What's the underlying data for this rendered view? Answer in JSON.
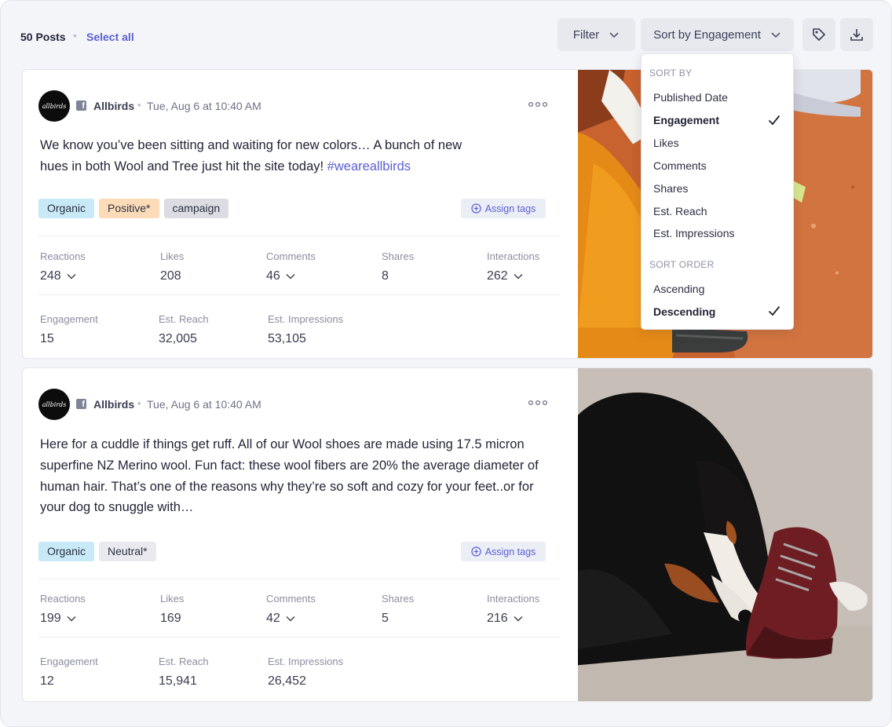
{
  "toolbar": {
    "post_count": "50 Posts",
    "separator": "•",
    "select_all": "Select all",
    "filter_label": "Filter",
    "sort_label": "Sort by Engagement"
  },
  "sort_menu": {
    "sort_by_heading": "SORT BY",
    "sort_by_options": [
      "Published Date",
      "Engagement",
      "Likes",
      "Comments",
      "Shares",
      "Est. Reach",
      "Est. Impressions"
    ],
    "selected_sort_by": "Engagement",
    "sort_order_heading": "SORT ORDER",
    "sort_order_options": [
      "Ascending",
      "Descending"
    ],
    "selected_sort_order": "Descending"
  },
  "posts": [
    {
      "avatar_text": "allbirds",
      "network_icon": "facebook-icon",
      "author": "Allbirds",
      "separator": "•",
      "timestamp": "Tue, Aug 6 at 10:40 AM",
      "text_lines": [
        "We know you’ve been sitting and waiting for new colors… A bunch of new",
        "hues in both Wool and Tree just hit the site today! "
      ],
      "hashtag": "#weareallbirds",
      "tags": [
        "Organic",
        "Positive*",
        "campaign"
      ],
      "assign_tags": "Assign tags",
      "metrics_row1": [
        {
          "label": "Reactions",
          "value": "248",
          "expandable": true
        },
        {
          "label": "Likes",
          "value": "208",
          "expandable": false
        },
        {
          "label": "Comments",
          "value": "46",
          "expandable": true
        },
        {
          "label": "Shares",
          "value": "8",
          "expandable": false
        },
        {
          "label": "Interactions",
          "value": "262",
          "expandable": true
        }
      ],
      "metrics_row2": [
        {
          "label": "Engagement",
          "value": "15"
        },
        {
          "label": "Est. Reach",
          "value": "32,005"
        },
        {
          "label": "Est. Impressions",
          "value": "53,105"
        }
      ]
    },
    {
      "avatar_text": "allbirds",
      "network_icon": "facebook-icon",
      "author": "Allbirds",
      "separator": "•",
      "timestamp": "Tue, Aug 6 at 10:40 AM",
      "text_lines": [
        "Here for a cuddle if things get ruff. All of our Wool shoes are made using 17.5 micron",
        "superfine NZ Merino wool. Fun fact: these wool fibers are 20% the average diameter of",
        "human hair. That’s one of the reasons why they’re so soft and cozy for your feet..or for",
        "your dog to snuggle with…"
      ],
      "tags": [
        "Organic",
        "Neutral*"
      ],
      "assign_tags": "Assign tags",
      "metrics_row1": [
        {
          "label": "Reactions",
          "value": "199",
          "expandable": true
        },
        {
          "label": "Likes",
          "value": "169",
          "expandable": false
        },
        {
          "label": "Comments",
          "value": "42",
          "expandable": true
        },
        {
          "label": "Shares",
          "value": "5",
          "expandable": false
        },
        {
          "label": "Interactions",
          "value": "216",
          "expandable": true
        }
      ],
      "metrics_row2": [
        {
          "label": "Engagement",
          "value": "12"
        },
        {
          "label": "Est. Reach",
          "value": "15,941"
        },
        {
          "label": "Est. Impressions",
          "value": "26,452"
        }
      ]
    }
  ],
  "colors": {
    "accent": "#5a5fd0",
    "background": "#f4f5f9",
    "tag_organic": "#c8eaf6",
    "tag_positive": "#fcdcb8",
    "tag_campaign": "#dcdde3",
    "tag_neutral": "#e9eaef"
  }
}
